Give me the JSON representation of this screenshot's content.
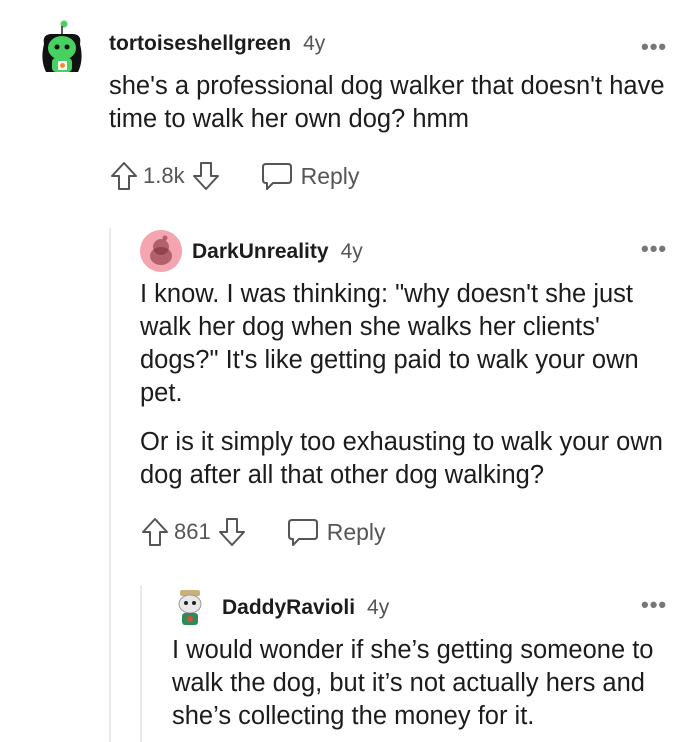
{
  "comments": [
    {
      "username": "tortoiseshellgreen",
      "age": "4y",
      "paragraphs": [
        "she's a professional dog walker that doesn't have time to walk her own dog? hmm"
      ],
      "votes": "1.8k",
      "reply_label": "Reply",
      "more_label": "•••"
    },
    {
      "username": "DarkUnreality",
      "age": "4y",
      "paragraphs": [
        "I know. I was thinking: \"why doesn't she just walk her dog when she walks her clients' dogs?\" It's like getting paid to walk your own pet.",
        "Or is it simply too exhausting to walk your own dog after all that other dog walking?"
      ],
      "votes": "861",
      "reply_label": "Reply",
      "more_label": "•••"
    },
    {
      "username": "DaddyRavioli",
      "age": "4y",
      "paragraphs": [
        "I would wonder if she’s getting someone to walk the dog, but it’s not actually hers and she’s collecting the money for it."
      ],
      "more_label": "•••"
    }
  ],
  "colors": {
    "thread_line": "#e9e9e9",
    "avatar_green": "#46d160",
    "avatar_pink": "#f4a5b0",
    "muted_text": "#555555"
  }
}
